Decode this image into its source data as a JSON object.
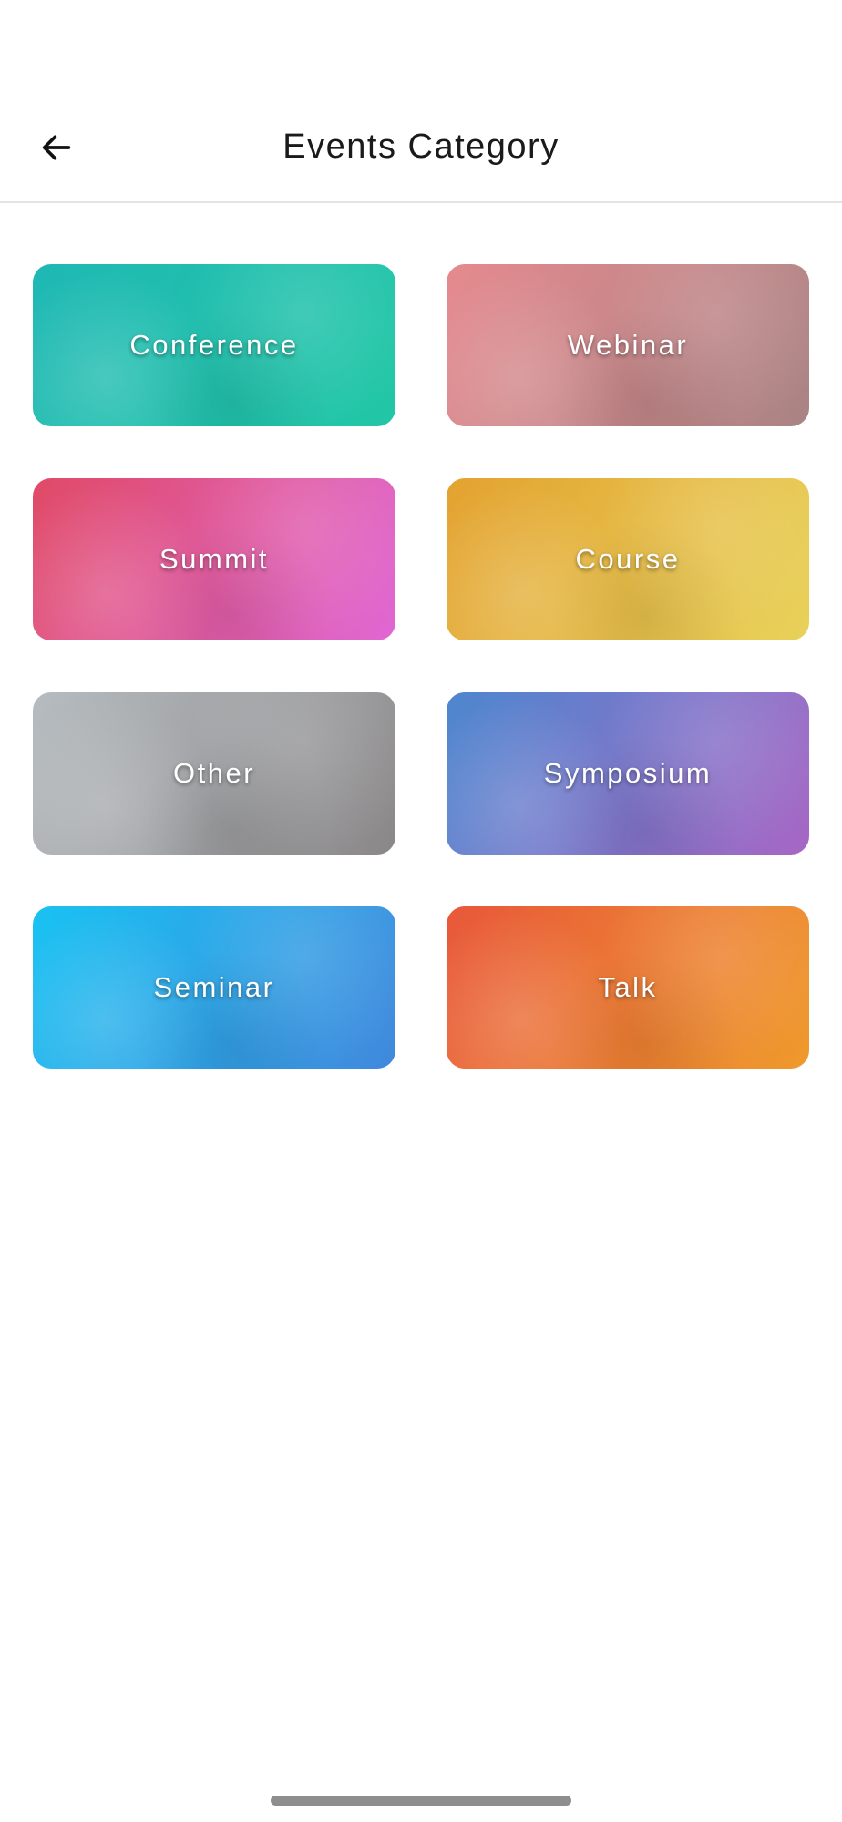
{
  "header": {
    "title": "Events Category",
    "back_icon": "arrow-left-icon"
  },
  "categories": [
    {
      "label": "Conference",
      "colors": [
        "#1fb8b4",
        "#22c7a6"
      ]
    },
    {
      "label": "Webinar",
      "colors": [
        "#e58a8f",
        "#a98383"
      ]
    },
    {
      "label": "Summit",
      "colors": [
        "#e04a66",
        "#e068d4"
      ]
    },
    {
      "label": "Course",
      "colors": [
        "#e3a230",
        "#e8d25a"
      ]
    },
    {
      "label": "Other",
      "colors": [
        "#b6bcc0",
        "#8a8788"
      ]
    },
    {
      "label": "Symposium",
      "colors": [
        "#4d87cf",
        "#a766c4"
      ]
    },
    {
      "label": "Seminar",
      "colors": [
        "#19c2f2",
        "#4188dc"
      ]
    },
    {
      "label": "Talk",
      "colors": [
        "#e8583a",
        "#ef9a2c"
      ]
    }
  ]
}
